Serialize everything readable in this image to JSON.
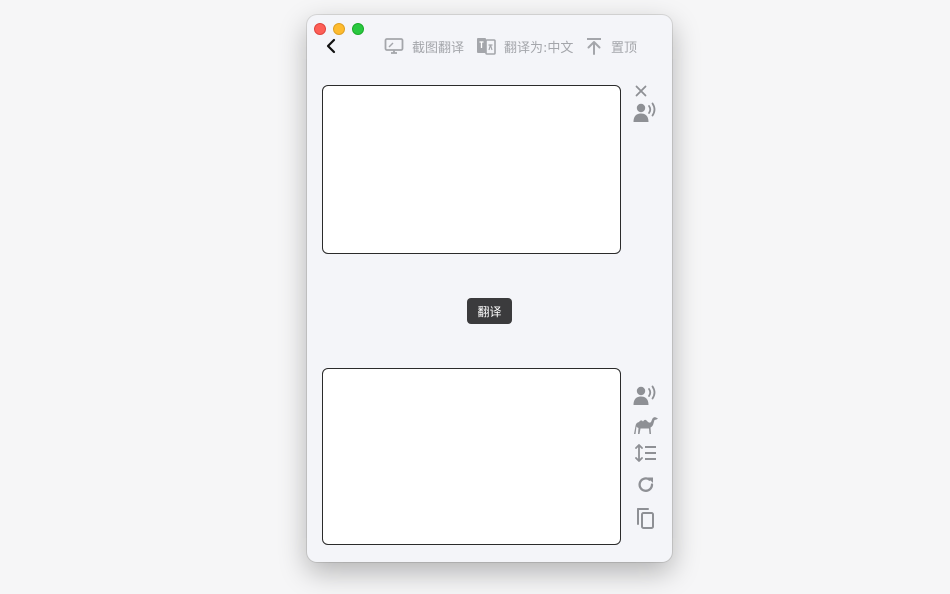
{
  "toolbar": {
    "screenshot_translate": "截图翻译",
    "translate_to": "翻译为:中文",
    "pin_top": "置顶"
  },
  "main": {
    "translate_button": "翻译",
    "input_text": "",
    "output_text": ""
  },
  "icons": {
    "back": "chevron-left-icon",
    "screenshot": "monitor-icon",
    "language": "language-swap-icon",
    "pin": "pin-top-icon",
    "clear": "close-icon",
    "speak_input": "speaker-person-icon",
    "speak_output": "speaker-person-icon",
    "camel_case": "camel-icon",
    "line_spacing": "line-spacing-icon",
    "retry": "refresh-icon",
    "copy": "copy-icon"
  },
  "colors": {
    "window_bg": "#f4f5f9",
    "icon_gray": "#a4a6ab",
    "button_bg": "#3b3b3d",
    "traffic_red": "#fd5f57",
    "traffic_yellow": "#febb2e",
    "traffic_green": "#29c840"
  }
}
